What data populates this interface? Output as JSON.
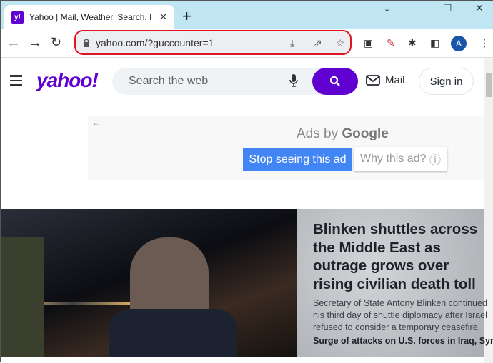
{
  "browser": {
    "tab_title": "Yahoo | Mail, Weather, Search, Politics",
    "favicon_text": "y!",
    "url": "yahoo.com/?guccounter=1",
    "avatar_letter": "A",
    "highlight_color": "#e0141e"
  },
  "header": {
    "logo": "yahoo!",
    "search_placeholder": "Search the web",
    "mail_label": "Mail",
    "signin_label": "Sign in",
    "brand_color": "#6001d2"
  },
  "ad": {
    "ads_by": "Ads by",
    "google": "Google",
    "stop_label": "Stop seeing this ad",
    "why_label": "Why this ad?",
    "stop_color": "#4285f4"
  },
  "story": {
    "headline": "Blinken shuttles across the Middle East as outrage grows over rising civilian death toll",
    "summary": "Secretary of State Antony Blinken continued his third day of shuttle diplomacy after Israel refused to consider a temporary ceasefire.",
    "related": "Surge of attacks on U.S. forces in Iraq, Syria"
  }
}
